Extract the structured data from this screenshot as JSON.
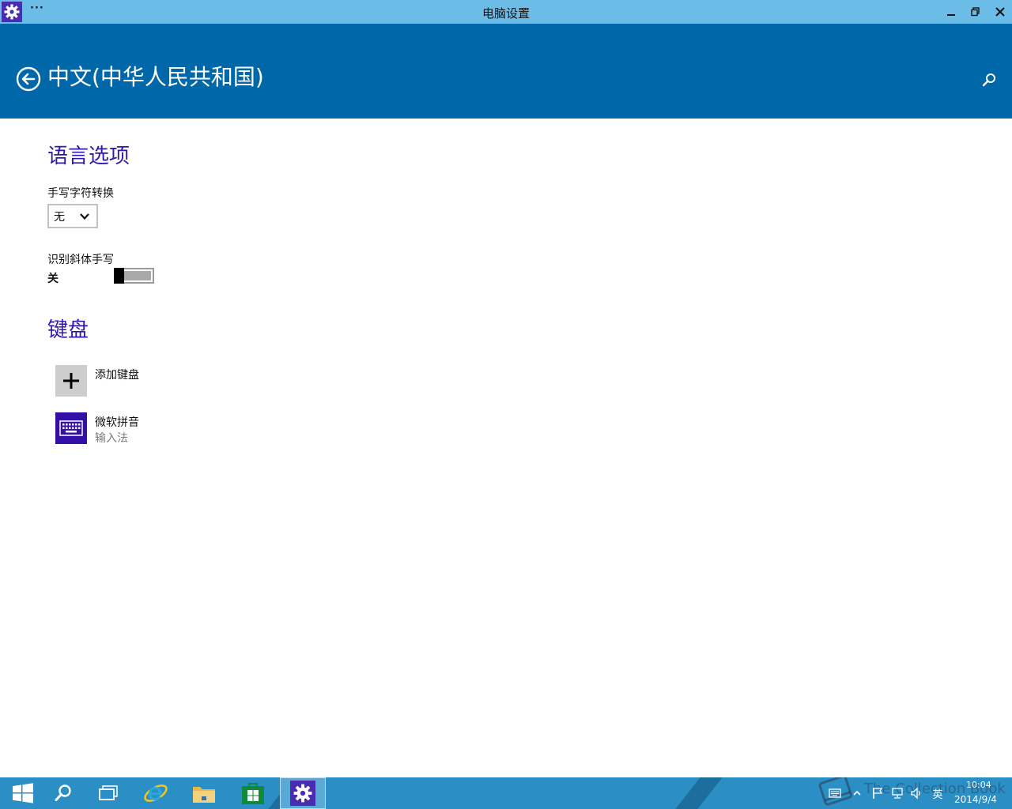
{
  "window": {
    "title": "电脑设置",
    "menu_label": "···"
  },
  "header": {
    "page_title": "中文(中华人民共和国)"
  },
  "language_options": {
    "heading": "语言选项",
    "handwriting_label": "手写字符转换",
    "handwriting_value": "无",
    "italic_label": "识别斜体手写",
    "italic_toggle_state": "关",
    "italic_toggle_on": false
  },
  "keyboard": {
    "heading": "键盘",
    "items": [
      {
        "name": "添加键盘",
        "subtitle": "",
        "icon": "plus-icon"
      },
      {
        "name": "微软拼音",
        "subtitle": "输入法",
        "icon": "keyboard-icon"
      }
    ]
  },
  "taskbar": {
    "apps": [
      "windows-start-icon",
      "search-icon",
      "task-view-icon",
      "internet-explorer-icon",
      "file-explorer-icon",
      "store-icon",
      "pc-settings-icon"
    ],
    "active_app": "pc-settings-icon",
    "ime_indicator": "英",
    "time": "10:04",
    "date": "2014/9/4",
    "watermark_text": "The Collection Book"
  },
  "colors": {
    "titlebar": "#6cbce8",
    "header": "#0067a8",
    "heading_text": "#3218a8",
    "tile_purple": "#3510a8",
    "taskbar": "#2b8fc6"
  }
}
